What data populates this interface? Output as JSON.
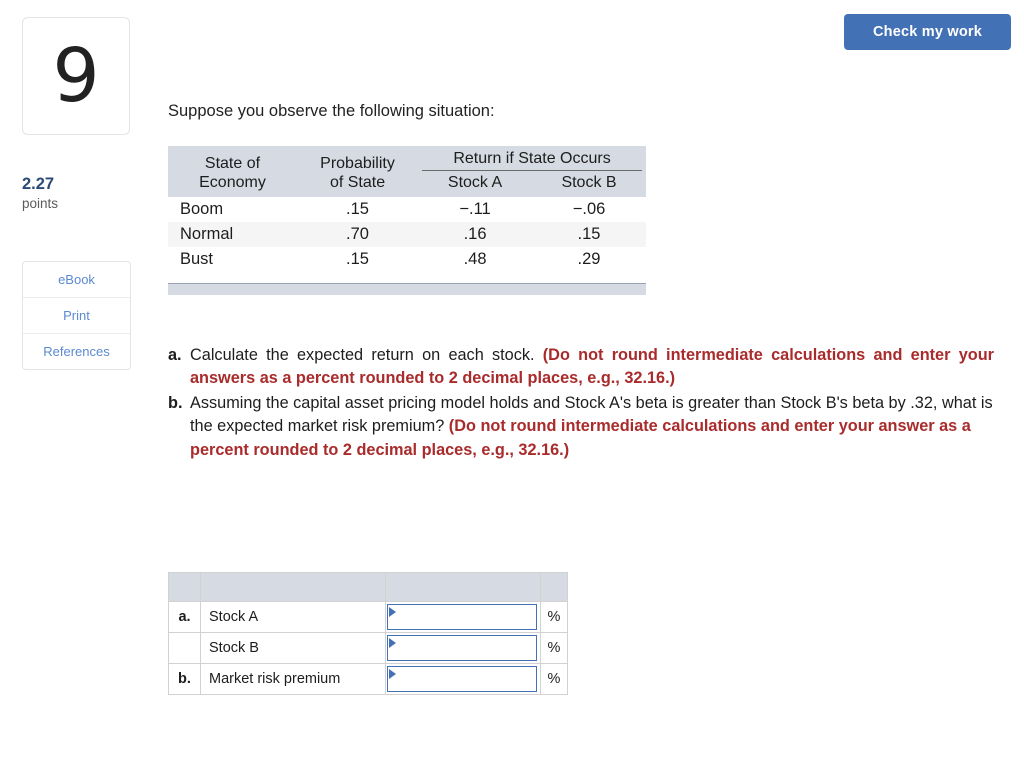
{
  "header": {
    "check_my_work_label": "Check my work"
  },
  "sidebar": {
    "question_number": "9",
    "points_value": "2.27",
    "points_label": "points",
    "tools": [
      {
        "label": "eBook",
        "name": "ebook"
      },
      {
        "label": "Print",
        "name": "print"
      },
      {
        "label": "References",
        "name": "references"
      }
    ]
  },
  "main": {
    "intro": "Suppose you observe the following situation:",
    "data_table": {
      "group_header": "Return if State Occurs",
      "columns": [
        "State of Economy",
        "Probability of State",
        "Stock A",
        "Stock B"
      ],
      "column_lines": [
        [
          "State of",
          "Economy"
        ],
        [
          "Probability",
          "of State"
        ],
        [
          "",
          "Stock A"
        ],
        [
          "",
          "Stock B"
        ]
      ],
      "rows": [
        {
          "state": "Boom",
          "probability": ".15",
          "stock_a": "−.11",
          "stock_b": "−.06"
        },
        {
          "state": "Normal",
          "probability": ".70",
          "stock_a": ".16",
          "stock_b": ".15"
        },
        {
          "state": "Bust",
          "probability": ".15",
          "stock_a": ".48",
          "stock_b": ".29"
        }
      ]
    },
    "questions": [
      {
        "marker": "a.",
        "plain_1": "Calculate the expected return on each stock. ",
        "emph_1": "(Do not round intermediate calculations and enter your answers as a percent rounded to 2 decimal places, e.g., 32.16.)"
      },
      {
        "marker": "b.",
        "plain_1": "Assuming the capital asset pricing model holds and Stock A's beta is greater than Stock B's beta by .32, what is the expected market risk premium? ",
        "emph_1": "(Do not round intermediate calculations and enter your answer as a percent rounded to 2 decimal places, e.g., 32.16.)"
      }
    ],
    "answer_table": {
      "rows": [
        {
          "letter": "a.",
          "label": "Stock A",
          "value": "",
          "unit": "%"
        },
        {
          "letter": "",
          "label": "Stock B",
          "value": "",
          "unit": "%"
        },
        {
          "letter": "b.",
          "label": "Market risk premium",
          "value": "",
          "unit": "%"
        }
      ]
    }
  },
  "colors": {
    "accent_blue": "#4371b5",
    "link_blue": "#5b8ad1",
    "points_blue": "#2b4a77",
    "emphasis_red": "#a92b2b",
    "table_header_bg": "#d5dae3",
    "stripe_gray": "#f5f5f5"
  }
}
